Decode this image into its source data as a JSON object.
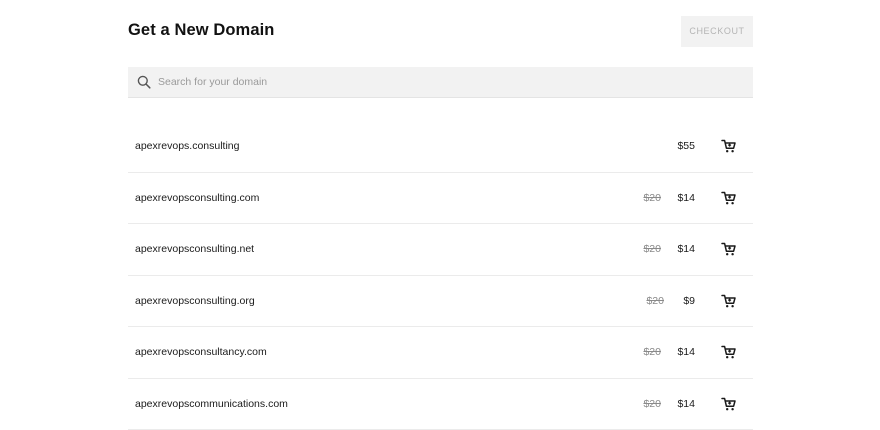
{
  "header": {
    "title": "Get a New Domain",
    "checkout_label": "CHECKOUT"
  },
  "search": {
    "placeholder": "Search for your domain",
    "value": "",
    "icon": "search-icon"
  },
  "results": [
    {
      "domain": "apexrevops.consulting",
      "old_price": "",
      "price": "$55"
    },
    {
      "domain": "apexrevopsconsulting.com",
      "old_price": "$20",
      "price": "$14"
    },
    {
      "domain": "apexrevopsconsulting.net",
      "old_price": "$20",
      "price": "$14"
    },
    {
      "domain": "apexrevopsconsulting.org",
      "old_price": "$20",
      "price": "$9"
    },
    {
      "domain": "apexrevopsconsultancy.com",
      "old_price": "$20",
      "price": "$14"
    },
    {
      "domain": "apexrevopscommunications.com",
      "old_price": "$20",
      "price": "$14"
    }
  ],
  "icons": {
    "cart": "add-to-cart-icon"
  },
  "colors": {
    "title": "#111111",
    "checkout_bg": "#f2f2f2",
    "checkout_text": "#b5b5b5",
    "search_bg": "#f2f2f2",
    "strikethrough": "#8a8a8a",
    "divider": "#ebebeb"
  }
}
